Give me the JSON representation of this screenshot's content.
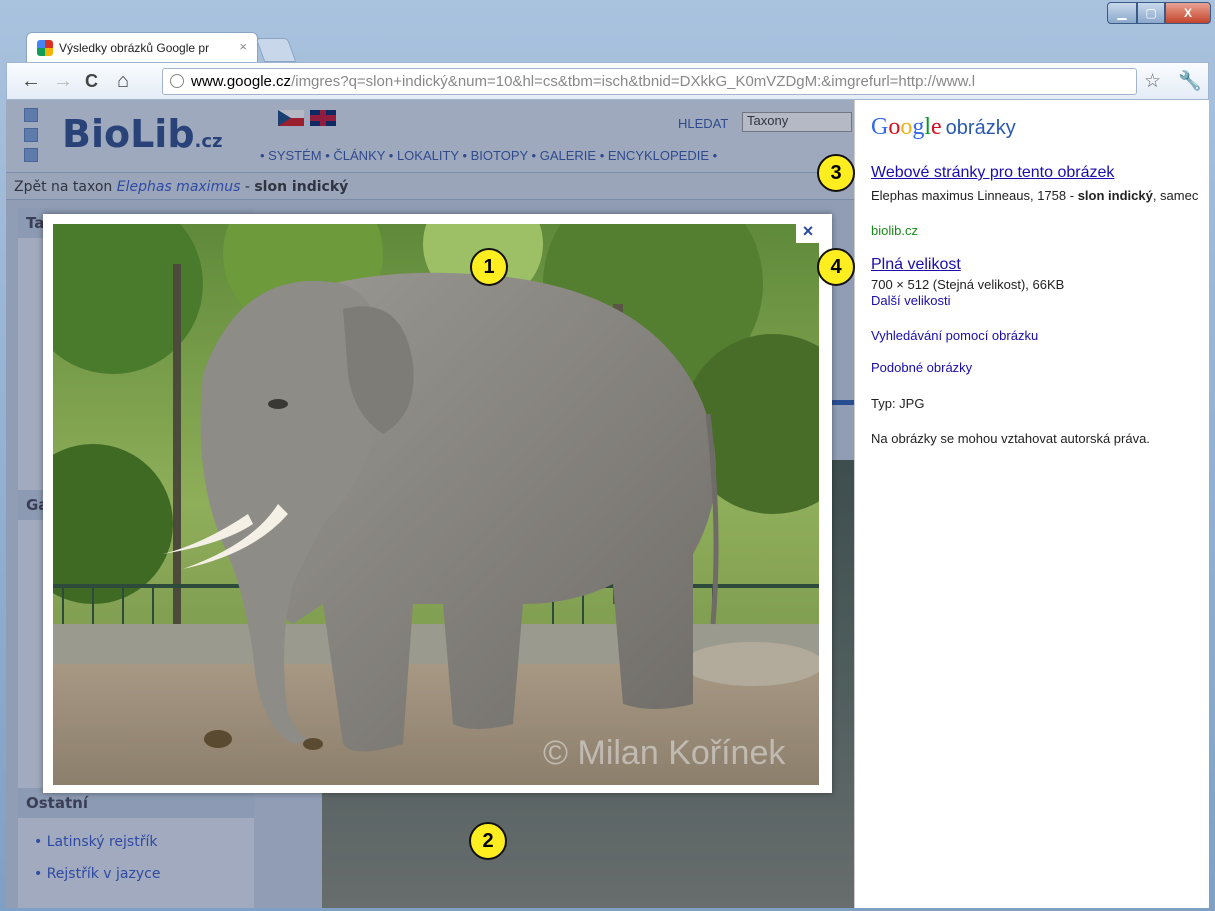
{
  "browser": {
    "tab_title": "Výsledky obrázků Google pr",
    "tab_close": "×",
    "url_host": "www.google.cz",
    "url_rest": "/imgres?q=slon+indický&num=10&hl=cs&tbm=isch&tbnid=DXkkG_K0mVZDgM:&imgrefurl=http://www.l",
    "window_buttons": {
      "minimize": "▁",
      "maximize": "▢",
      "close": "X"
    },
    "nav": {
      "back": "←",
      "forward": "→",
      "reload": "C",
      "home": "⌂"
    },
    "star": "☆",
    "wrench": "🔧"
  },
  "biolib": {
    "logo": "BioLib",
    "logo_suffix": ".cz",
    "search_label": "HLEDAT",
    "search_value": "Taxony",
    "nav": "• SYSTÉM • ČLÁNKY • LOKALITY • BIOTOPY • GALERIE • ENCYKLOPEDIE •",
    "breadcrumb_prefix": "Zpět na taxon ",
    "breadcrumb_taxon": "Elephas maximus",
    "breadcrumb_sep": " - ",
    "breadcrumb_name": "slon indický",
    "sidebar_heads": [
      "Ta",
      "Ga",
      "Ostatní"
    ],
    "sidebar_links": [
      "• Latinský rejstřík",
      "• Rejstřík v jazyce"
    ]
  },
  "lightbox": {
    "close": "×",
    "watermark": "© Milan Kořínek"
  },
  "google_panel": {
    "logo_letters": [
      "G",
      "o",
      "o",
      "g",
      "l",
      "e"
    ],
    "logo_sub": "obrázky",
    "page_link": "Webové stránky pro tento obrázek",
    "page_desc_1": "Elephas maximus Linneaus, 1758 - ",
    "page_desc_bold": "slon indický",
    "page_desc_2": ", samec",
    "page_domain": "biolib.cz",
    "full_size_link": "Plná velikost",
    "full_size_info": "700 × 512 (Stejná velikost), 66KB",
    "more_sizes": "Další velikosti",
    "search_by_image": "Vyhledávání pomocí obrázku",
    "similar_images": "Podobné obrázky",
    "type": "Typ:  JPG",
    "copyright": "Na obrázky se mohou vztahovat autorská práva."
  },
  "callouts": [
    "1",
    "2",
    "3",
    "4"
  ]
}
